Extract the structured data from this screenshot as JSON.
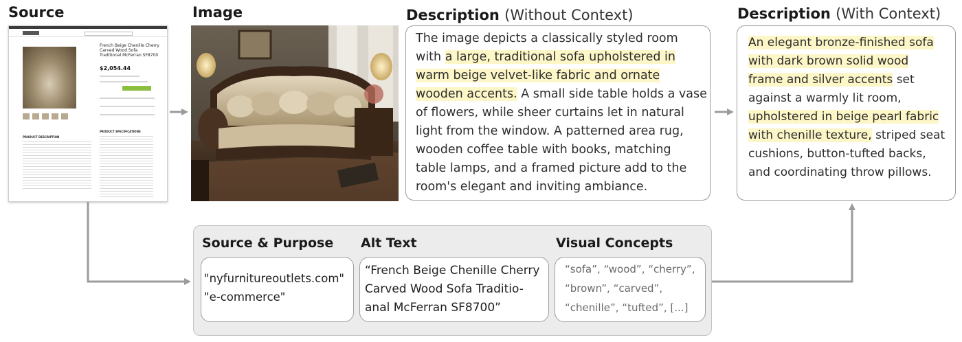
{
  "headings": {
    "source": "Source",
    "image": "Image",
    "desc_without_main": "Description",
    "desc_without_sub": "(Without Context)",
    "desc_with_main": "Description",
    "desc_with_sub": "(With Context)"
  },
  "source_page": {
    "product_title_lines": [
      "French Beige Chenille Cherry",
      "Carved Wood Sofa",
      "Traditional McFerran SF8700"
    ],
    "price": "$2,054.44",
    "section_product_description": "PRODUCT DESCRIPTION",
    "section_product_specifications": "PRODUCT SPECIFICATIONS"
  },
  "desc_without": {
    "lines": [
      [
        {
          "t": "The image depicts a classically styled room",
          "hl": false
        }
      ],
      [
        {
          "t": "with ",
          "hl": false
        },
        {
          "t": "a large, traditional sofa upholstered in",
          "hl": true
        }
      ],
      [
        {
          "t": "warm beige velvet-like fabric and ornate",
          "hl": true
        }
      ],
      [
        {
          "t": "wooden accents.",
          "hl": true
        },
        {
          "t": " A small side table holds a vase",
          "hl": false
        }
      ],
      [
        {
          "t": "of flowers, while sheer curtains let in natural",
          "hl": false
        }
      ],
      [
        {
          "t": "light from the window. A patterned area rug,",
          "hl": false
        }
      ],
      [
        {
          "t": "wooden coffee table with books, matching",
          "hl": false
        }
      ],
      [
        {
          "t": "table lamps, and a framed picture add to the",
          "hl": false
        }
      ],
      [
        {
          "t": "room's elegant and inviting ambiance.",
          "hl": false
        }
      ]
    ]
  },
  "desc_with": {
    "lines": [
      [
        {
          "t": "An elegant bronze-finished sofa",
          "hl": true
        }
      ],
      [
        {
          "t": "with dark brown solid wood",
          "hl": true
        }
      ],
      [
        {
          "t": "frame and silver accents",
          "hl": true
        },
        {
          "t": " set",
          "hl": false
        }
      ],
      [
        {
          "t": "against a warmly lit room,",
          "hl": false
        }
      ],
      [
        {
          "t": "upholstered in beige pearl fabric",
          "hl": true
        }
      ],
      [
        {
          "t": "with chenille texture,",
          "hl": true
        },
        {
          "t": " striped seat",
          "hl": false
        }
      ],
      [
        {
          "t": "cushions, button-tufted backs,",
          "hl": false
        }
      ],
      [
        {
          "t": "and coordinating throw pillows.",
          "hl": false
        }
      ]
    ]
  },
  "context": {
    "source_purpose": {
      "label": "Source & Purpose",
      "lines": [
        "\"nyfurnitureoutlets.com\"",
        "\"e-commerce\""
      ]
    },
    "alt_text": {
      "label": "Alt Text",
      "lines": [
        "“French Beige Chenille Cherry",
        "Carved Wood Sofa Traditio-",
        "anal McFerran SF8700”"
      ]
    },
    "visual_concepts": {
      "label": "Visual Concepts",
      "lines": [
        "“sofa”, “wood”, “cherry”,",
        "“brown”, “carved”,",
        "“chenille”, “tufted”, [...]"
      ]
    }
  },
  "colors": {
    "highlight": "#fdf6c7",
    "arrow": "#9b9b9b",
    "panel_bg": "#ececec"
  }
}
